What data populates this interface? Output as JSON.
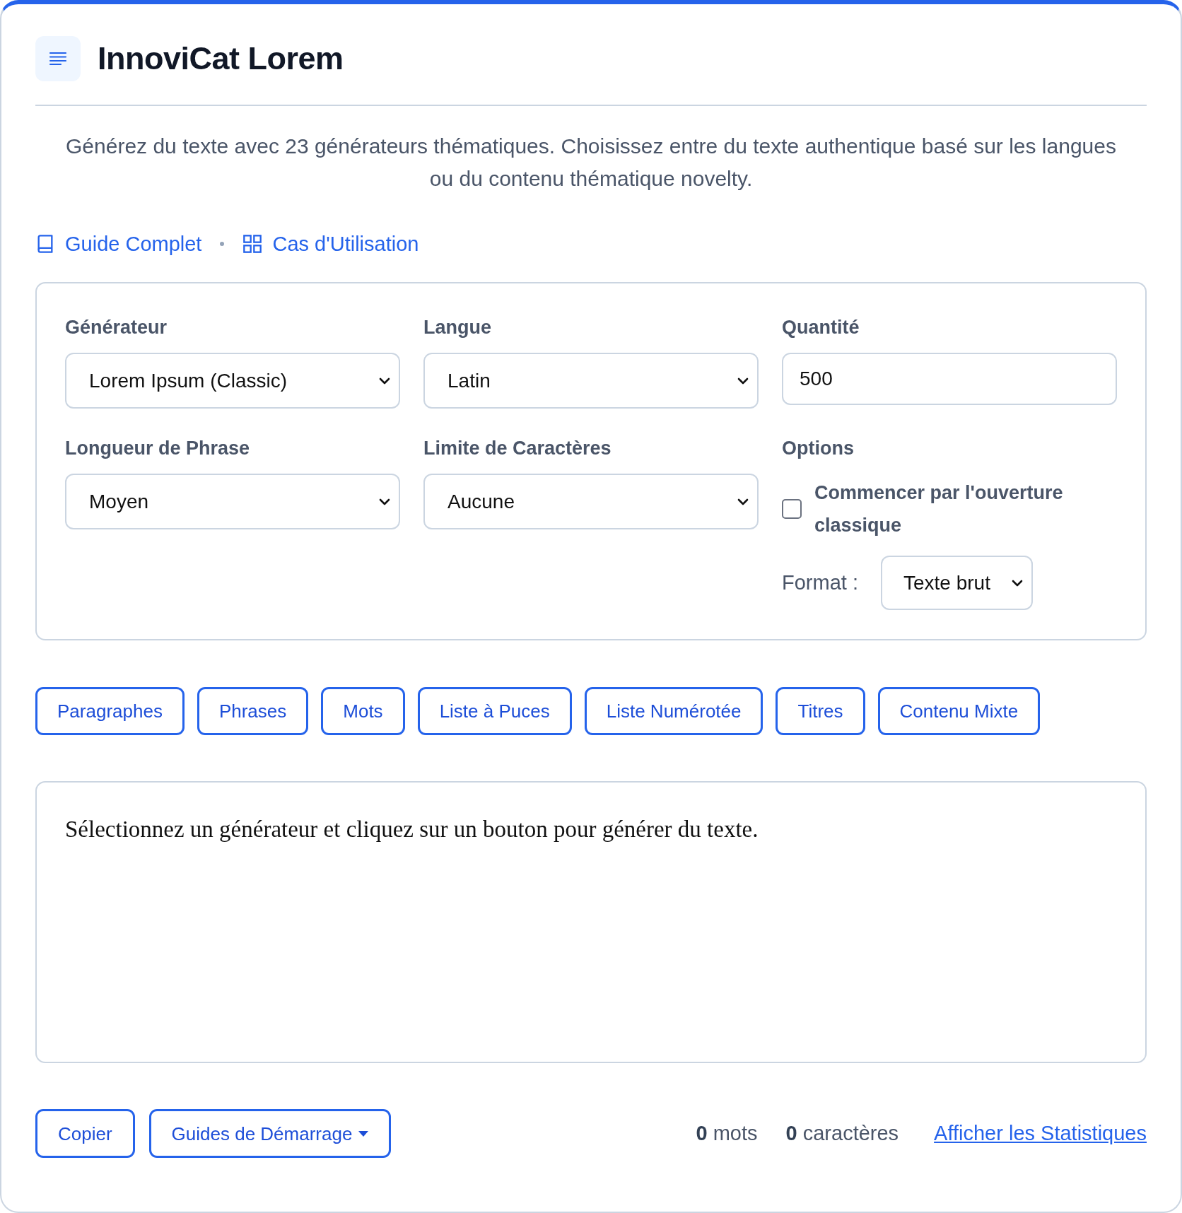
{
  "header": {
    "title": "InnoviCat Lorem"
  },
  "description": "Générez du texte avec 23 générateurs thématiques. Choisissez entre du texte authentique basé sur les langues ou du contenu thématique novelty.",
  "links": [
    {
      "label": "Guide Complet",
      "kind": "book"
    },
    {
      "label": "Cas d'Utilisation",
      "kind": "grid"
    }
  ],
  "settings": {
    "fields": [
      {
        "kind": "select",
        "label": "Générateur",
        "value": "Lorem Ipsum (Classic)"
      },
      {
        "kind": "select",
        "label": "Langue",
        "value": "Latin"
      },
      {
        "kind": "input",
        "label": "Quantité",
        "value": "500"
      },
      {
        "kind": "select",
        "label": "Longueur de Phrase",
        "value": "Moyen"
      },
      {
        "kind": "select",
        "label": "Limite de Caractères",
        "value": "Aucune"
      },
      {
        "kind": "options",
        "label": "Options",
        "checkbox": {
          "label": "Commencer par l'ouverture classique",
          "checked": false
        },
        "format": {
          "label": "Format :",
          "value": "Texte brut"
        }
      }
    ]
  },
  "generate_buttons": [
    "Paragraphes",
    "Phrases",
    "Mots",
    "Liste à Puces",
    "Liste Numérotée",
    "Titres",
    "Contenu Mixte"
  ],
  "output": {
    "text": "Sélectionnez un générateur et cliquez sur un bouton pour générer du texte."
  },
  "footer": {
    "buttons": [
      {
        "label": "Copier",
        "kind": "plain"
      },
      {
        "label": "Guides de Démarrage",
        "kind": "dropdown"
      }
    ],
    "stats": [
      "**0** mots",
      "**0** caractères"
    ],
    "link": "Afficher les Statistiques"
  }
}
